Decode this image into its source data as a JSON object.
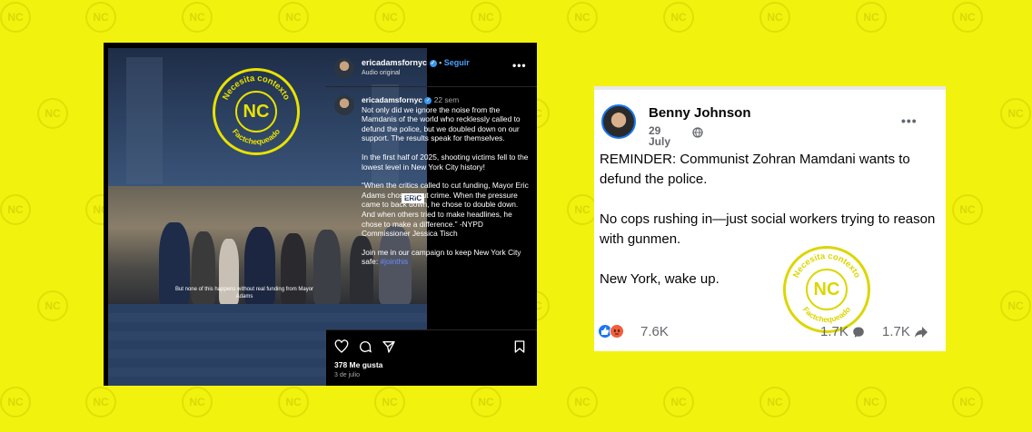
{
  "watermark": {
    "label": "NC",
    "icon": "nc-watermark-icon"
  },
  "instagram": {
    "header": {
      "username": "ericadamsfornyc",
      "follow_label": "Seguir",
      "audio_label": "Audio original",
      "separator": "•",
      "more_label": "•••"
    },
    "video": {
      "stamp_top": "Necesita contexto",
      "stamp_center": "NC",
      "stamp_bottom": "Factchequeado",
      "overlay_tag": "ERIC",
      "subtitle": "But none of this happens without real funding from Mayor Adams"
    },
    "post": {
      "username": "ericadamsfornyc",
      "time": "22 sem",
      "paragraphs": [
        "Not only did we ignore the noise from the Mamdanis of the world who recklessly called to defund the police, but we doubled down on our support. The results speak for themselves.",
        "In the first half of 2025, shooting victims fell to the lowest level in New York City history!",
        "“When the critics called to cut funding, Mayor Eric Adams chose to cut crime. When the pressure came to back down, he chose to double down. And when others tried to make headlines, he chose to make a difference.” -NYPD Commissioner Jessica Tisch",
        "Join me in our campaign to keep New York City safe: "
      ],
      "hashtag": "#jointhis"
    },
    "actions": {
      "like_icon": "heart-icon",
      "comment_icon": "comment-icon",
      "share_icon": "send-icon",
      "save_icon": "bookmark-icon"
    },
    "likes": "378 Me gusta",
    "date": "3 de julio"
  },
  "facebook": {
    "name": "Benny Johnson",
    "date": "29 July",
    "privacy_icon": "globe-icon",
    "more_label": "•••",
    "paragraphs": [
      "REMINDER: Communist Zohran Mamdani wants to defund the police.",
      "No cops rushing in—just social workers trying to reason with gunmen.",
      "New York, wake up."
    ],
    "stamp_top": "Necesita contexto",
    "stamp_center": "NC",
    "stamp_bottom": "Factchequeado",
    "reactions": {
      "like_icon": "like-reaction-icon",
      "angry_icon": "angry-reaction-icon",
      "count": "7.6K"
    },
    "comments": "1.7K",
    "shares": "1.7K"
  },
  "colors": {
    "background": "#f2f20f",
    "stamp": "#e8e200",
    "instagram_bg": "#000000",
    "facebook_blue": "#1877f2"
  }
}
